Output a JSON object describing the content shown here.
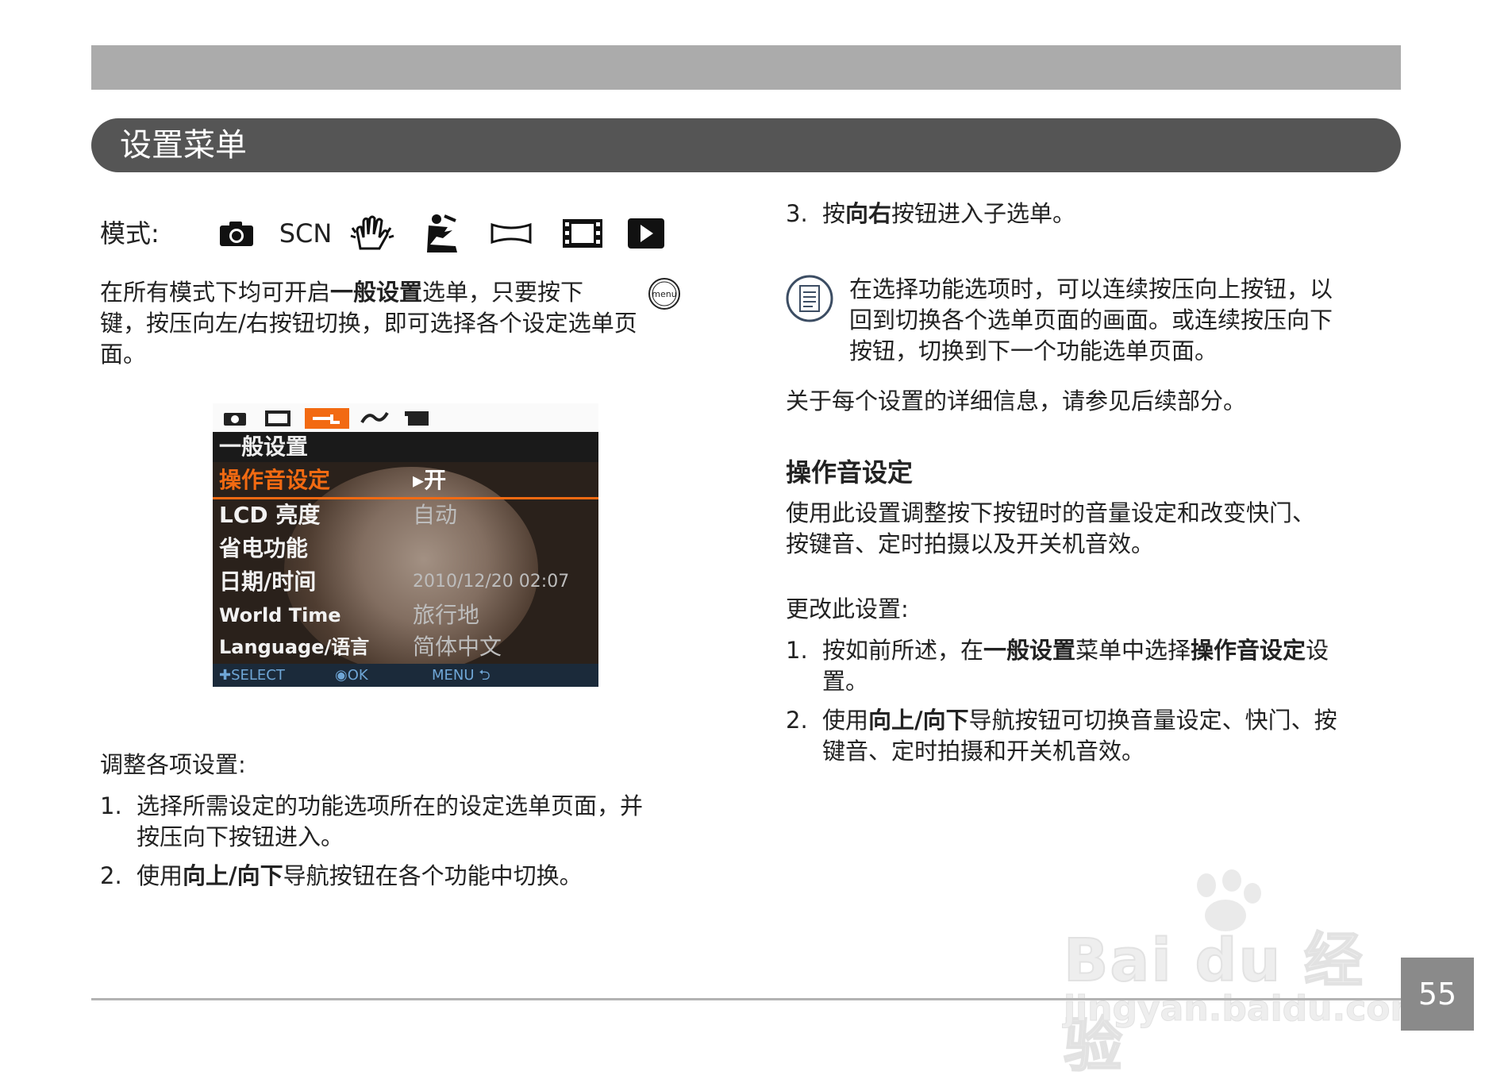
{
  "header": {
    "title": "设置菜单"
  },
  "mode_row": {
    "label": "模式:",
    "scn_label": "SCN",
    "icons": [
      "camera-icon",
      "scn-mode",
      "hand-shake-icon",
      "portrait-pose-icon",
      "panorama-icon",
      "movie-icon",
      "play-icon"
    ]
  },
  "left": {
    "intro": {
      "pre": "在所有模式下均可开启",
      "bold": "一般设置",
      "post": "选单，只要按下",
      "menu_button": "menu",
      "line2": "键，按压向左/右按钮切换，即可选择各个设定选单页",
      "line3": "面。"
    },
    "adjust_heading": "调整各项设置:",
    "steps": [
      {
        "num": "1.",
        "line1": "选择所需设定的功能选项所在的设定选单页面，并",
        "line2": "按压向下按钮进入。"
      },
      {
        "num": "2.",
        "pre": "使用",
        "bold": "向上/向下",
        "post": "导航按钮在各个功能中切换。"
      }
    ]
  },
  "screen": {
    "header": "一般设置",
    "rows": [
      {
        "label": "操作音设定",
        "value": "开",
        "selected": true
      },
      {
        "label": "LCD 亮度",
        "value": "自动"
      },
      {
        "label": "省电功能",
        "value": ""
      },
      {
        "label": "日期/时间",
        "value": "2010/12/20 02:07"
      },
      {
        "label": "World Time",
        "value": "旅行地"
      },
      {
        "label": "Language/语言",
        "value": "简体中文"
      }
    ],
    "footer": {
      "select": "SELECT",
      "ok": "OK",
      "menu": "MENU"
    },
    "colors": {
      "accent": "#f26a12"
    }
  },
  "right": {
    "step3": {
      "num": "3.",
      "pre": "按",
      "bold": "向右",
      "post": "按钮进入子选单。"
    },
    "note": {
      "line1": "在选择功能选项时，可以连续按压向上按钮，以",
      "line2": "回到切换各个选单页面的画面。或连续按压向下",
      "line3": "按钮，切换到下一个功能选单页面。"
    },
    "details": "关于每个设置的详细信息，请参见后续部分。",
    "section_title": "操作音设定",
    "section_desc": {
      "line1": "使用此设置调整按下按钮时的音量设定和改变快门、",
      "line2": "按键音、定时拍摄以及开关机音效。"
    },
    "change_heading": "更改此设置:",
    "steps": [
      {
        "num": "1.",
        "pre": "按如前所述，在",
        "bold1": "一般设置",
        "mid": "菜单中选择",
        "bold2": "操作音设定",
        "post": "设",
        "line2": "置。"
      },
      {
        "num": "2.",
        "pre": "使用",
        "bold": "向上/向下",
        "post": "导航按钮可切换音量设定、快门、按",
        "line2": "键音、定时拍摄和开关机音效。"
      }
    ]
  },
  "watermark": {
    "brand": "Bai du 经验",
    "url": "jingyan.baidu.com"
  },
  "page_number": "55"
}
